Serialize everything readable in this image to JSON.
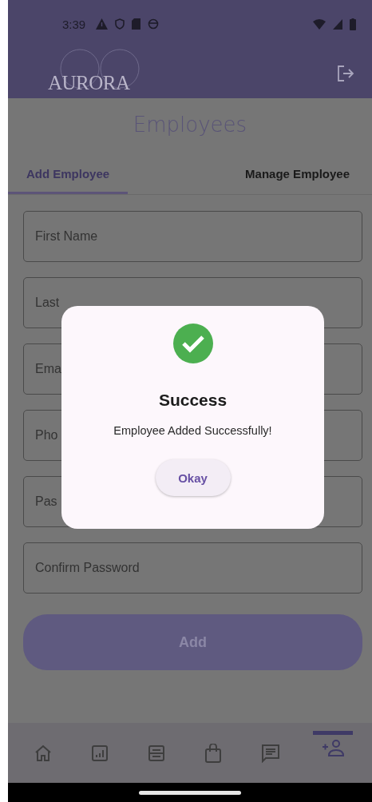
{
  "status_bar": {
    "time": "3:39"
  },
  "app_bar": {
    "logo": "AURORA"
  },
  "page_title": "Employees",
  "tabs": [
    {
      "label": "Add Employee",
      "selected": true
    },
    {
      "label": "Manage Employee",
      "selected": false
    }
  ],
  "form_fields": [
    {
      "placeholder": "First Name"
    },
    {
      "placeholder": "Last"
    },
    {
      "placeholder": "Ema"
    },
    {
      "placeholder": "Pho"
    },
    {
      "placeholder": "Pas"
    },
    {
      "placeholder": "Confirm Password"
    }
  ],
  "add_button": "Add",
  "bottom_nav": [
    {
      "kind": "home",
      "selected": false
    },
    {
      "kind": "chart",
      "selected": false
    },
    {
      "kind": "inventory",
      "selected": false
    },
    {
      "kind": "bag",
      "selected": false
    },
    {
      "kind": "message",
      "selected": false
    },
    {
      "kind": "add-person",
      "selected": true
    }
  ],
  "dialog": {
    "title": "Success",
    "message": "Employee Added Successfully!",
    "button": "Okay"
  }
}
